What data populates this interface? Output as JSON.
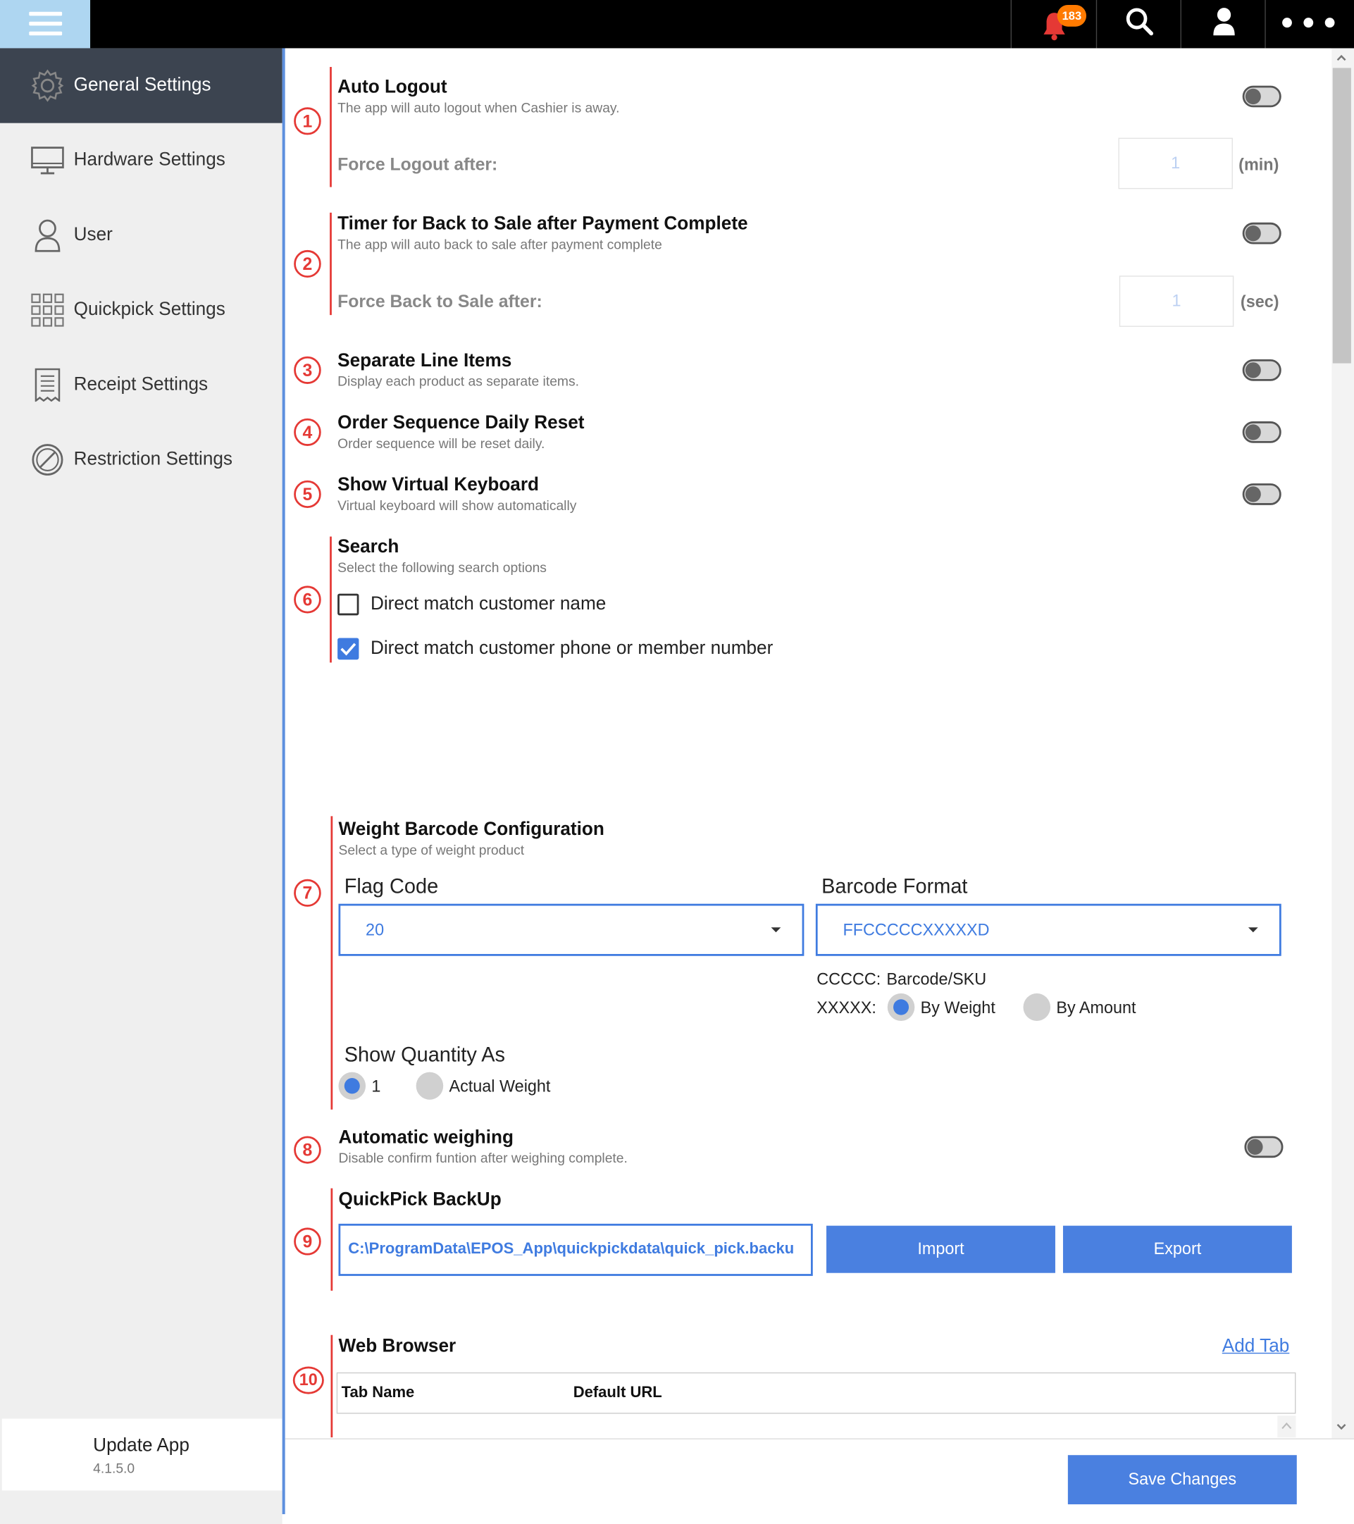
{
  "topbar": {
    "notification_count": "183",
    "icons": [
      "menu-icon",
      "bell-icon",
      "search-icon",
      "user-icon",
      "more-icon"
    ]
  },
  "sidebar": {
    "items": [
      {
        "label": "General Settings",
        "icon": "gear-icon",
        "active": true
      },
      {
        "label": "Hardware Settings",
        "icon": "monitor-icon",
        "active": false
      },
      {
        "label": "User",
        "icon": "user-icon",
        "active": false
      },
      {
        "label": "Quickpick Settings",
        "icon": "grid-icon",
        "active": false
      },
      {
        "label": "Receipt Settings",
        "icon": "receipt-icon",
        "active": false
      },
      {
        "label": "Restriction Settings",
        "icon": "restriction-icon",
        "active": false
      }
    ],
    "update": {
      "label": "Update App",
      "version": "4.1.5.0"
    }
  },
  "sections": {
    "auto_logout": {
      "number": "1",
      "title": "Auto Logout",
      "desc": "The app will auto logout when Cashier is away.",
      "toggle": false,
      "sub_label": "Force Logout after:",
      "value": "1",
      "unit": "(min)"
    },
    "timer_back": {
      "number": "2",
      "title": "Timer for Back to Sale after Payment Complete",
      "desc": "The app will auto back to sale after payment complete",
      "toggle": false,
      "sub_label": "Force Back to Sale after:",
      "value": "1",
      "unit": "(sec)"
    },
    "separate_lines": {
      "number": "3",
      "title": "Separate Line Items",
      "desc": "Display each product as separate items.",
      "toggle": false
    },
    "order_reset": {
      "number": "4",
      "title": "Order Sequence Daily Reset",
      "desc": "Order sequence will be reset daily.",
      "toggle": false
    },
    "virtual_keyboard": {
      "number": "5",
      "title": "Show Virtual Keyboard",
      "desc": "Virtual keyboard will show automatically",
      "toggle": false
    },
    "search": {
      "number": "6",
      "title": "Search",
      "desc": "Select the following search options",
      "options": [
        {
          "label": "Direct match customer name",
          "checked": false
        },
        {
          "label": "Direct match customer phone or member number",
          "checked": true
        }
      ]
    },
    "weight_barcode": {
      "number": "7",
      "title": "Weight Barcode Configuration",
      "desc": "Select a type of weight product",
      "flag_code_label": "Flag Code",
      "flag_code_value": "20",
      "barcode_format_label": "Barcode Format",
      "barcode_format_value": "FFCCCCCXXXXXD",
      "cccc_key": "CCCCC:",
      "cccc_value": "Barcode/SKU",
      "xxxx_key": "XXXXX:",
      "xxxx_options": [
        {
          "label": "By Weight",
          "selected": true
        },
        {
          "label": "By Amount",
          "selected": false
        }
      ],
      "show_qty_label": "Show Quantity As",
      "show_qty_options": [
        {
          "label": "1",
          "selected": true
        },
        {
          "label": "Actual Weight",
          "selected": false
        }
      ]
    },
    "auto_weighing": {
      "number": "8",
      "title": "Automatic weighing",
      "desc": "Disable confirm funtion after weighing complete.",
      "toggle": false
    },
    "quickpick_backup": {
      "number": "9",
      "title": "QuickPick BackUp",
      "path": "C:\\ProgramData\\EPOS_App\\quickpickdata\\quick_pick.backu",
      "import_label": "Import",
      "export_label": "Export"
    },
    "web_browser": {
      "number": "10",
      "title": "Web Browser",
      "add_tab_label": "Add Tab",
      "columns": [
        "Tab Name",
        "Default URL"
      ]
    }
  },
  "footer": {
    "save_label": "Save Changes"
  },
  "colors": {
    "accent": "#4a80e0",
    "marker": "#e53935",
    "sidebar_active": "#3c4450",
    "sidebar_bg": "#efefef",
    "badge": "#ff7a00"
  }
}
